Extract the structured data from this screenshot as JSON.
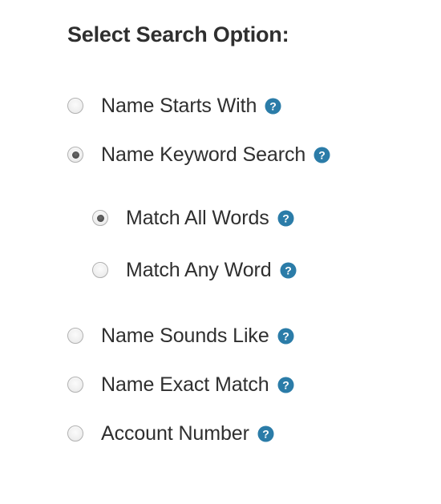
{
  "heading": "Select Search Option:",
  "colors": {
    "text": "#2f2f2f",
    "help_icon": "#2b7ca8",
    "help_icon_glyph": "#ffffff",
    "radio_border": "#b0b0b0",
    "radio_fill": "#ececec",
    "radio_dot": "#4c4c4c",
    "background": "#ffffff"
  },
  "help_icon_name": "help-question-icon",
  "help_icon_glyph": "?",
  "options": [
    {
      "id": "name-starts-with",
      "label": "Name Starts With",
      "selected": false,
      "level": 1,
      "help": "?"
    },
    {
      "id": "name-keyword-search",
      "label": "Name Keyword Search",
      "selected": true,
      "level": 1,
      "help": "?"
    },
    {
      "id": "match-all-words",
      "label": "Match All Words",
      "selected": true,
      "level": 2,
      "help": "?"
    },
    {
      "id": "match-any-word",
      "label": "Match Any Word",
      "selected": false,
      "level": 2,
      "help": "?"
    },
    {
      "id": "name-sounds-like",
      "label": "Name Sounds Like",
      "selected": false,
      "level": 1,
      "help": "?"
    },
    {
      "id": "name-exact-match",
      "label": "Name Exact Match",
      "selected": false,
      "level": 1,
      "help": "?"
    },
    {
      "id": "account-number",
      "label": "Account Number",
      "selected": false,
      "level": 1,
      "help": "?"
    }
  ]
}
